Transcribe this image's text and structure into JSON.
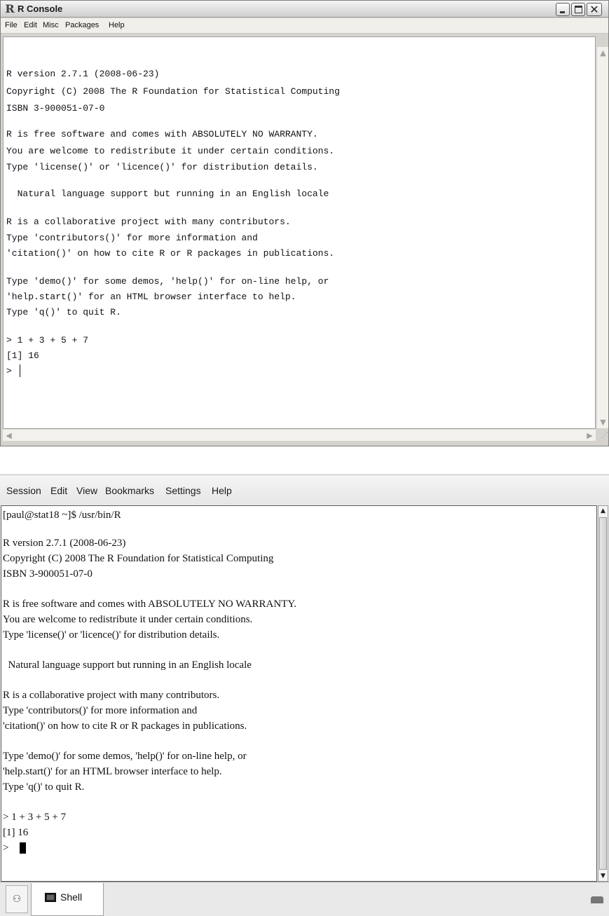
{
  "windows_console": {
    "title": "R Console",
    "logo": "R",
    "menu": {
      "file": "File",
      "edit": "Edit",
      "misc": "Misc",
      "packages": "Packages",
      "help": "Help"
    },
    "lines": [
      "R version 2.7.1 (2008-06-23)",
      "Copyright (C) 2008 The R Foundation for Statistical Computing",
      "ISBN 3-900051-07-0",
      "R is free software and comes with ABSOLUTELY NO WARRANTY.",
      "You are welcome to redistribute it under certain conditions.",
      "Type 'license()' or 'licence()' for distribution details.",
      "  Natural language support but running in an English locale",
      "R is a collaborative project with many contributors.",
      "Type 'contributors()' for more information and",
      "'citation()' on how to cite R or R packages in publications.",
      "Type 'demo()' for some demos, 'help()' for on-line help, or",
      "'help.start()' for an HTML browser interface to help.",
      "Type 'q()' to quit R.",
      "> 1 + 3 + 5 + 7",
      "[1] 16",
      "> "
    ]
  },
  "terminal": {
    "menu": {
      "session": "Session",
      "edit": "Edit",
      "view": "View",
      "bookmarks": "Bookmarks",
      "settings": "Settings",
      "help": "Help"
    },
    "lines": [
      "[paul@stat18 ~]$ /usr/bin/R",
      "R version 2.7.1 (2008-06-23)",
      "Copyright (C) 2008 The R Foundation for Statistical Computing",
      "ISBN 3-900051-07-0",
      "R is free software and comes with ABSOLUTELY NO WARRANTY.",
      "You are welcome to redistribute it under certain conditions.",
      "Type 'license()' or 'licence()' for distribution details.",
      "  Natural language support but running in an English locale",
      "R is a collaborative project with many contributors.",
      "Type 'contributors()' for more information and",
      "'citation()' on how to cite R or R packages in publications.",
      "Type 'demo()' for some demos, 'help()' for on-line help, or",
      "'help.start()' for an HTML browser interface to help.",
      "Type 'q()' to quit R.",
      "> 1 + 3 + 5 + 7",
      "[1] 16",
      "> "
    ],
    "tab_label": "Shell"
  }
}
